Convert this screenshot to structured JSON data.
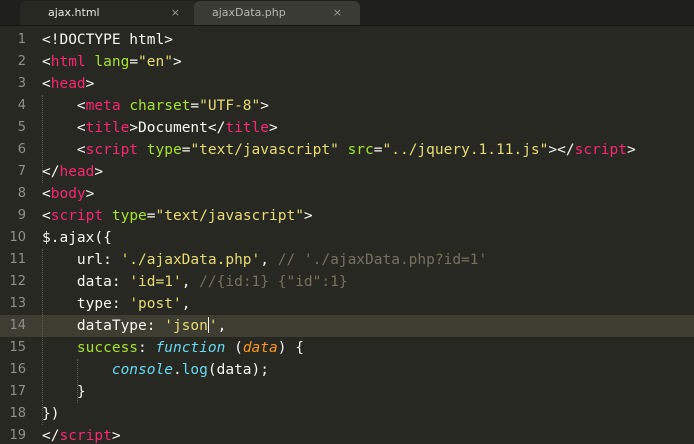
{
  "tabs": [
    {
      "label": "ajax.html",
      "close": "×",
      "active": true
    },
    {
      "label": "ajaxData.php",
      "close": "×",
      "active": false
    }
  ],
  "editor": {
    "active_line": 14,
    "lines": [
      {
        "n": "1",
        "tokens": [
          [
            "plain",
            "<!DOCTYPE html>"
          ]
        ]
      },
      {
        "n": "2",
        "tokens": [
          [
            "plain",
            "<"
          ],
          [
            "tag",
            "html"
          ],
          [
            "plain",
            " "
          ],
          [
            "attr",
            "lang"
          ],
          [
            "plain",
            "="
          ],
          [
            "str",
            "\"en\""
          ],
          [
            "plain",
            ">"
          ]
        ]
      },
      {
        "n": "3",
        "tokens": [
          [
            "plain",
            "<"
          ],
          [
            "tag",
            "head"
          ],
          [
            "plain",
            ">"
          ]
        ]
      },
      {
        "n": "4",
        "tokens": [
          [
            "plain",
            "    <"
          ],
          [
            "tag",
            "meta"
          ],
          [
            "plain",
            " "
          ],
          [
            "attr",
            "charset"
          ],
          [
            "plain",
            "="
          ],
          [
            "str",
            "\"UTF-8\""
          ],
          [
            "plain",
            ">"
          ]
        ]
      },
      {
        "n": "5",
        "tokens": [
          [
            "plain",
            "    <"
          ],
          [
            "tag",
            "title"
          ],
          [
            "plain",
            ">Document</"
          ],
          [
            "tag",
            "title"
          ],
          [
            "plain",
            ">"
          ]
        ]
      },
      {
        "n": "6",
        "tokens": [
          [
            "plain",
            "    <"
          ],
          [
            "tag",
            "script"
          ],
          [
            "plain",
            " "
          ],
          [
            "attr",
            "type"
          ],
          [
            "plain",
            "="
          ],
          [
            "str",
            "\"text/javascript\""
          ],
          [
            "plain",
            " "
          ],
          [
            "attr",
            "src"
          ],
          [
            "plain",
            "="
          ],
          [
            "str",
            "\"../jquery.1.11.js\""
          ],
          [
            "plain",
            "></"
          ],
          [
            "tag",
            "script"
          ],
          [
            "plain",
            ">"
          ]
        ]
      },
      {
        "n": "7",
        "tokens": [
          [
            "plain",
            "</"
          ],
          [
            "tag",
            "head"
          ],
          [
            "plain",
            ">"
          ]
        ]
      },
      {
        "n": "8",
        "tokens": [
          [
            "plain",
            "<"
          ],
          [
            "tag",
            "body"
          ],
          [
            "plain",
            ">"
          ]
        ]
      },
      {
        "n": "9",
        "tokens": [
          [
            "plain",
            "<"
          ],
          [
            "tag",
            "script"
          ],
          [
            "plain",
            " "
          ],
          [
            "attr",
            "type"
          ],
          [
            "plain",
            "="
          ],
          [
            "str",
            "\"text/javascript\""
          ],
          [
            "plain",
            ">"
          ]
        ]
      },
      {
        "n": "10",
        "tokens": [
          [
            "plain",
            "$.ajax({"
          ]
        ]
      },
      {
        "n": "11",
        "tokens": [
          [
            "plain",
            "    url: "
          ],
          [
            "str",
            "'./ajaxData.php'"
          ],
          [
            "plain",
            ", "
          ],
          [
            "comment",
            "// './ajaxData.php?id=1'"
          ]
        ]
      },
      {
        "n": "12",
        "tokens": [
          [
            "plain",
            "    data: "
          ],
          [
            "str",
            "'id=1'"
          ],
          [
            "plain",
            ", "
          ],
          [
            "comment",
            "//{id:1} {\"id\":1}"
          ]
        ]
      },
      {
        "n": "13",
        "tokens": [
          [
            "plain",
            "    type: "
          ],
          [
            "str",
            "'post'"
          ],
          [
            "plain",
            ","
          ]
        ]
      },
      {
        "n": "14",
        "tokens": [
          [
            "plain",
            "    dataType: "
          ],
          [
            "str",
            "'json"
          ],
          [
            "caret",
            ""
          ],
          [
            "str",
            "'"
          ],
          [
            "plain",
            ","
          ]
        ]
      },
      {
        "n": "15",
        "tokens": [
          [
            "attr",
            "    success"
          ],
          [
            "plain",
            ": "
          ],
          [
            "kw",
            "function"
          ],
          [
            "plain",
            " ("
          ],
          [
            "param",
            "data"
          ],
          [
            "plain",
            ") {"
          ]
        ]
      },
      {
        "n": "16",
        "tokens": [
          [
            "plain",
            "        "
          ],
          [
            "kw",
            "console"
          ],
          [
            "plain",
            "."
          ],
          [
            "prop",
            "log"
          ],
          [
            "plain",
            "(data);"
          ]
        ]
      },
      {
        "n": "17",
        "tokens": [
          [
            "plain",
            "    }"
          ]
        ]
      },
      {
        "n": "18",
        "tokens": [
          [
            "plain",
            "})"
          ]
        ]
      },
      {
        "n": "19",
        "tokens": [
          [
            "plain",
            "</"
          ],
          [
            "tag",
            "script"
          ],
          [
            "plain",
            ">"
          ]
        ]
      }
    ]
  }
}
